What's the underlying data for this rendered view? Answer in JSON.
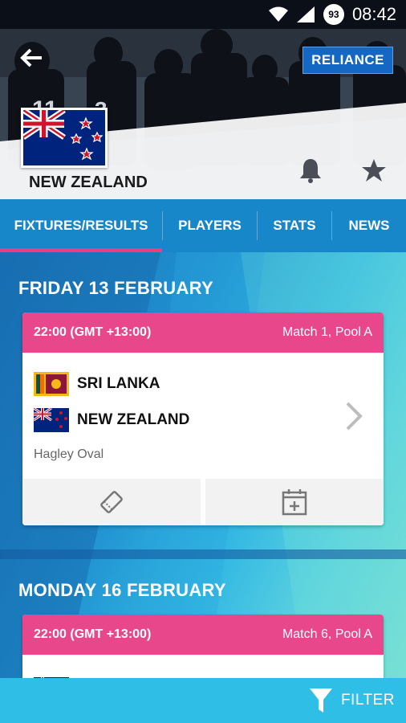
{
  "status_bar": {
    "time": "08:42",
    "battery_level": "93"
  },
  "header": {
    "team_name": "NEW ZEALAND",
    "sponsor": "RELIANCE"
  },
  "tabs": [
    {
      "label": "FIXTURES/RESULTS",
      "active": true
    },
    {
      "label": "PLAYERS",
      "active": false
    },
    {
      "label": "STATS",
      "active": false
    },
    {
      "label": "NEWS",
      "active": false
    }
  ],
  "fixtures": [
    {
      "date": "FRIDAY 13 FEBRUARY",
      "time": "22:00 (GMT +13:00)",
      "match": "Match 1, Pool A",
      "team1": "SRI LANKA",
      "team2": "NEW ZEALAND",
      "venue": "Hagley Oval"
    },
    {
      "date": "MONDAY 16 FEBRUARY",
      "time": "22:00 (GMT +13:00)",
      "match": "Match 6, Pool A"
    }
  ],
  "filter": {
    "label": "FILTER"
  },
  "colors": {
    "accent_pink": "#e8478b",
    "tab_bg": "#1887ca",
    "filter_bg": "#2fbfe6"
  }
}
